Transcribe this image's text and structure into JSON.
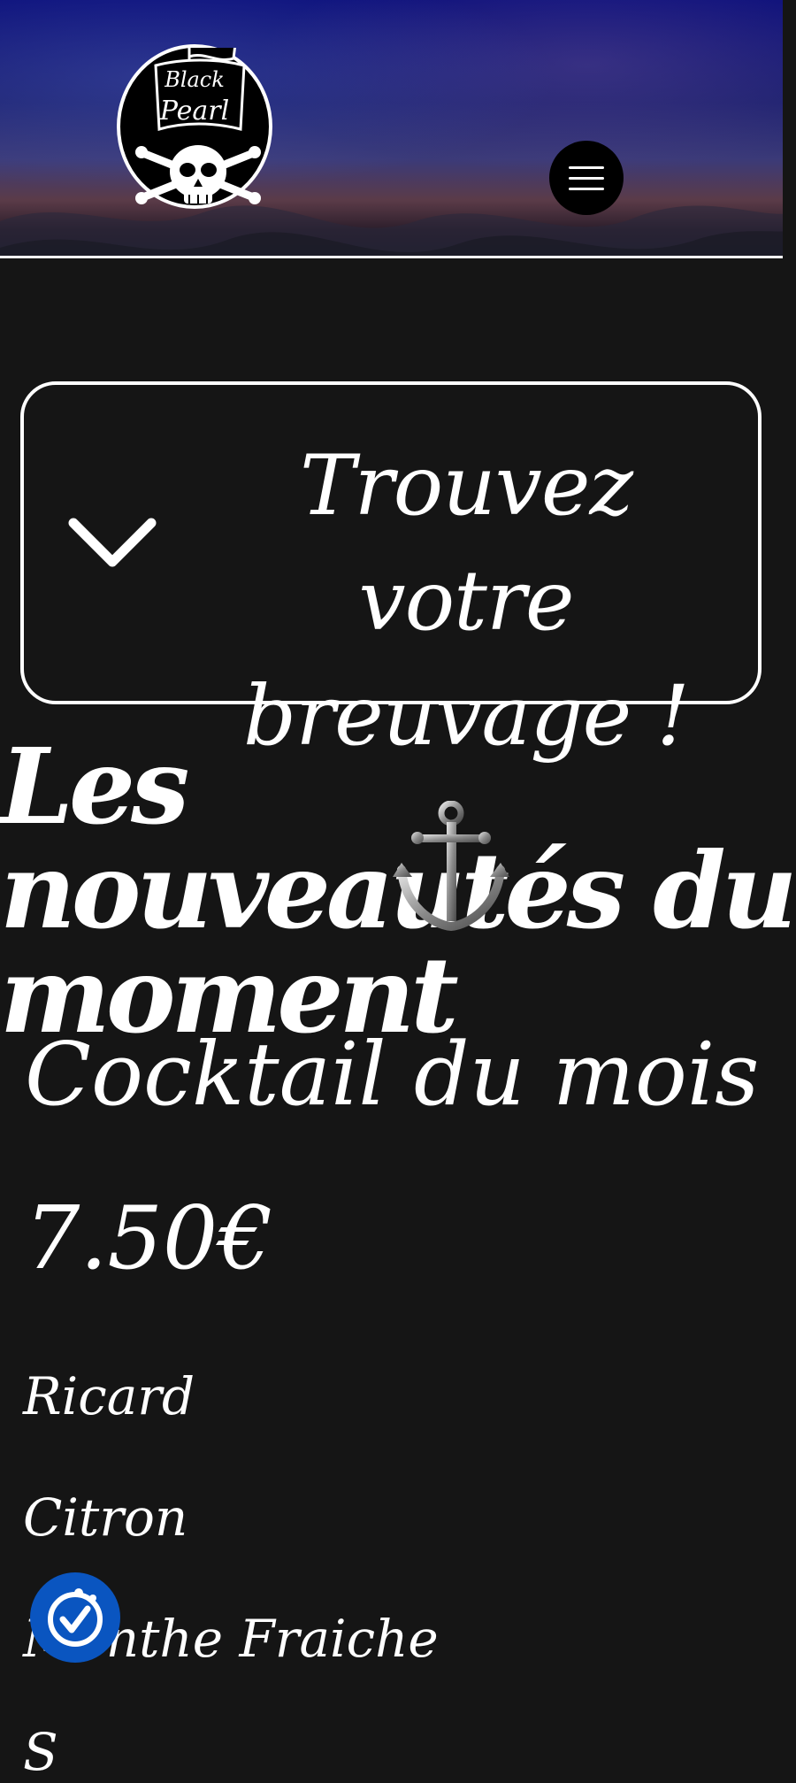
{
  "header": {
    "logo": {
      "line1": "Black",
      "line2": "Pearl"
    },
    "menu_icon": "hamburger-menu-icon"
  },
  "finder": {
    "title_line1": "Trouvez votre",
    "title_line2": "breuvage !",
    "icon": "chevron-down-icon"
  },
  "section": {
    "title_line1": "Les nouveautés du",
    "title_line2": "moment",
    "icon": "anchor-icon"
  },
  "cocktail": {
    "title": "Cocktail du mois",
    "price": "7.50€",
    "ingredients": [
      "Ricard",
      "Citron",
      "Menthe Fraiche",
      "S"
    ]
  },
  "accessibility": {
    "icon": "accessibility-icon"
  },
  "colors": {
    "background": "#151515",
    "accent": "#0a55c0",
    "header": "#0b0f7a"
  }
}
